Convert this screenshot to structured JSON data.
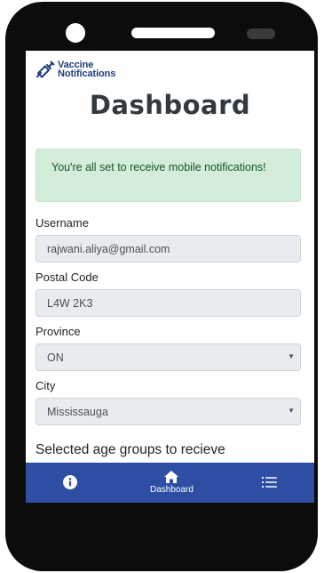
{
  "app": {
    "brand_line1": "Vaccine",
    "brand_line2": "Notifications"
  },
  "page": {
    "title": "Dashboard"
  },
  "alert": {
    "message": "You're all set to receive mobile notifications!"
  },
  "form": {
    "username_label": "Username",
    "username_value": "rajwani.aliya@gmail.com",
    "postal_label": "Postal Code",
    "postal_value": "L4W 2K3",
    "province_label": "Province",
    "province_value": "ON",
    "city_label": "City",
    "city_value": "Mississauga"
  },
  "section": {
    "age_groups_heading": "Selected age groups to recieve"
  },
  "bottom_nav": {
    "items": [
      {
        "icon": "info-circle-icon",
        "label": ""
      },
      {
        "icon": "home-icon",
        "label": "Dashboard"
      },
      {
        "icon": "list-icon",
        "label": ""
      }
    ]
  },
  "colors": {
    "brand": "#213c82",
    "nav_background": "#2d4ea2",
    "alert_background": "#d4edda",
    "alert_text": "#155724"
  }
}
